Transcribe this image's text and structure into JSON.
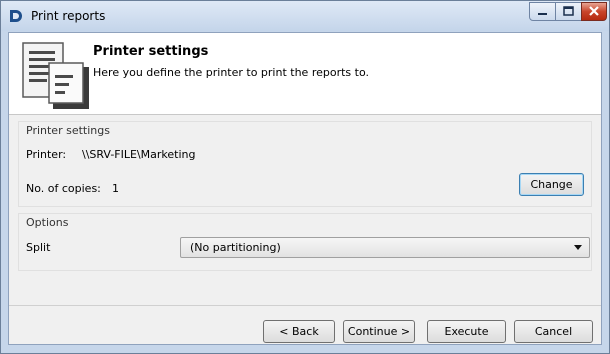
{
  "window": {
    "title": "Print reports"
  },
  "header": {
    "title": "Printer settings",
    "subtitle": "Here you define the printer to print the reports to."
  },
  "printer_group": {
    "legend": "Printer settings",
    "printer_label": "Printer:",
    "printer_value": "\\\\SRV-FILE\\Marketing",
    "copies_label": "No. of copies:",
    "copies_value": "1",
    "change_button": "Change"
  },
  "options_group": {
    "legend": "Options",
    "split_label": "Split",
    "split_value": "(No partitioning)"
  },
  "footer": {
    "back": "< Back",
    "continue": "Continue >",
    "execute": "Execute",
    "cancel": "Cancel"
  }
}
